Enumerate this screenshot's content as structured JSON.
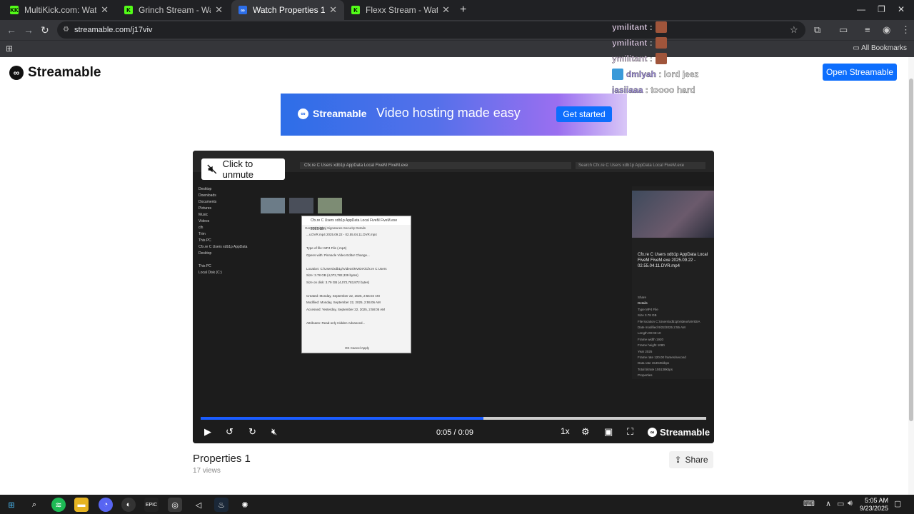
{
  "browser": {
    "tabs": [
      {
        "label": "MultiKick.com: Watch Multiple",
        "favicon": "KK",
        "color": "#53fc18"
      },
      {
        "label": "Grinch Stream - Watch Live on K",
        "favicon": "K",
        "color": "#53fc18"
      },
      {
        "label": "Watch Properties 1 | Streamabl",
        "favicon": "∞",
        "color": "#ffffff"
      },
      {
        "label": "Flexx Stream - Watch Live on Ki",
        "favicon": "K",
        "color": "#53fc18"
      }
    ],
    "url": "streamable.com/j17viv",
    "all_bookmarks": "All Bookmarks"
  },
  "chat": [
    {
      "user": "ymilitant",
      "sep": ":",
      "msg": ""
    },
    {
      "user": "ymilitant",
      "sep": ":",
      "msg": ""
    },
    {
      "user": "ymilitant",
      "sep": ":",
      "msg": ""
    },
    {
      "user": "dmlyah",
      "sep": ":",
      "msg": "lord jeez"
    },
    {
      "user": "jasiiaaa",
      "sep": ":",
      "msg": "toooo hard"
    }
  ],
  "header": {
    "logo": "Streamable",
    "open_button": "Open Streamable"
  },
  "banner": {
    "logo": "Streamable",
    "tagline": "Video hosting made easy",
    "cta": "Get started"
  },
  "player": {
    "unmute": "Click to unmute",
    "time": "0:05 / 0:09",
    "progress": 0.56,
    "speed": "1x",
    "brand": "Streamable",
    "video_frame": {
      "address": "Cfx.re  C  Users  xdb1p  AppData  Local  FiveM  FiveM.exe",
      "search": "Search Cfx.re  C  Users  xdb1p  AppData  Local  FiveM.exe",
      "sidebar": [
        "Desktop",
        "Downloads",
        "Documents",
        "Pictures",
        "Music",
        "Videos",
        "clh",
        "Trim",
        "This PC",
        "Cfx.re  C  Users xdb1p AppData",
        "Desktop",
        "",
        "This PC",
        "Local Disk (C:)"
      ],
      "file_title": "Cfx.re  C  Users xdb1p AppData Local FiveM FiveM.exe 2025.09.22 - 02.55.04.11.DVR.mp4",
      "share": "Share",
      "details_label": "Details",
      "details": [
        "Type  MP4 File",
        "Size  3.78 GB",
        "File location  C:\\Users\\xdb1p\\Videos\\NVIDIA",
        "Date modified  9/22/2025 2:55 AM",
        "Length  00:03:10",
        "Frame width  1920",
        "Frame height  1080",
        "Year  2025",
        "Frame rate  120.00 frames/second",
        "Data rate  154945kbps",
        "Total bitrate  155138kbps"
      ],
      "properties": "Properties",
      "dialog": {
        "title": "Cfx.re  C  Users xdb1p AppData Local FiveM FiveM.exe 2025.09...",
        "tabs": "General   Digital Signatures   Security   Details",
        "rows": [
          "...x.DVR.mp4  2025.09.22 - 02.55.04.11.DVR.mp4",
          "",
          "Type of file:  MP4 File (.mp4)",
          "Opens with:  Pinnacle Video Editor   Change...",
          "",
          "Location:  C:\\Users\\xdb1p\\Videos\\NVIDIA\\Cfx.re  C  Users",
          "Size:  3.78 GB (4,072,782,339 bytes)",
          "Size on disk:  3.79 GB (4,072,783,872 bytes)",
          "",
          "Created:  Monday, September 22, 2025, 2:55:04 AM",
          "Modified:  Monday, September 22, 2025, 2:55:06 AM",
          "Accessed:  Yesterday, September 22, 2025, 2:58:05 AM",
          "",
          "Attributes:  Read-only  Hidden   Advanced..."
        ],
        "buttons": "OK      Cancel      Apply"
      }
    }
  },
  "video": {
    "title": "Properties 1",
    "views": "17 views",
    "share": "Share"
  },
  "taskbar": {
    "time": "5:05 AM",
    "date": "9/23/2025"
  }
}
